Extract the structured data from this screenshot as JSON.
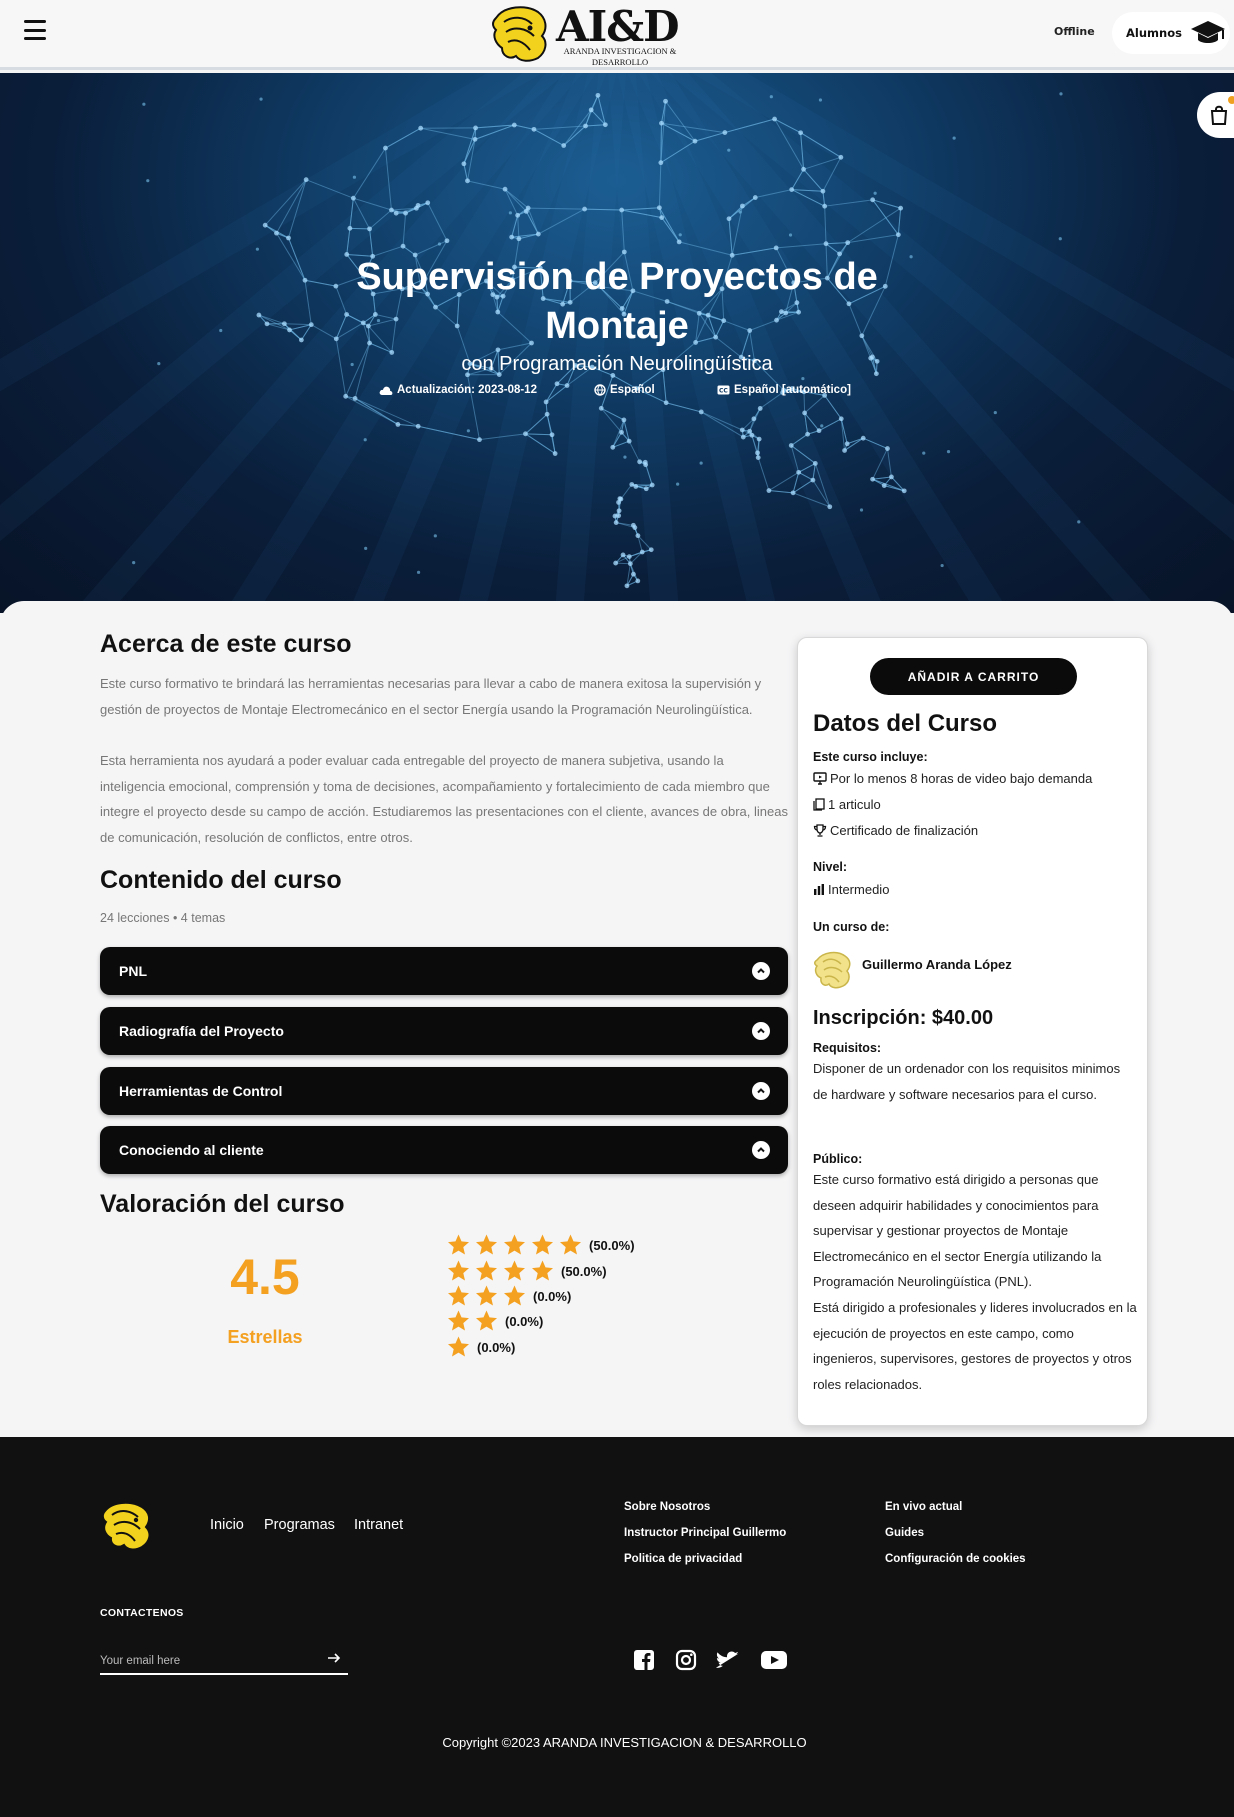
{
  "header": {
    "logo_text": "AI&D",
    "logo_subtitle": "ARANDA INVESTIGACION & DESARROLLO",
    "status": "Offline",
    "students_button": "Alumnos"
  },
  "hero": {
    "title": "Supervisión de Proyectos de Montaje",
    "subtitle": "con Programación Neurolingüística",
    "updated": "Actualización: 2023-08-12",
    "language": "Español",
    "captions": "Español [automático]"
  },
  "about": {
    "heading": "Acerca de este curso",
    "paragraphs": [
      "Este curso formativo te brindará las herramientas necesarias para llevar a cabo de manera exitosa la supervisión y gestión de proyectos de Montaje Electromecánico en el sector Energía usando la Programación Neurolingüística.",
      "Esta herramienta nos ayudará a poder evaluar cada entregable del proyecto de manera subjetiva, usando la inteligencia emocional, comprensión y toma de decisiones, acompañamiento y fortalecimiento de cada miembro que integre el proyecto desde su campo de acción. Estudiaremos las presentaciones con el cliente, avances de obra, lineas de comunicación, resolución de conflictos, entre otros."
    ]
  },
  "content": {
    "heading": "Contenido del curso",
    "summary": "24 lecciones • 4 temas",
    "modules": [
      "PNL",
      "Radiografía del Proyecto",
      "Herramientas de Control",
      "Conociendo al cliente"
    ]
  },
  "rating": {
    "heading": "Valoración del curso",
    "score": "4.5",
    "label": "Estrellas",
    "breakdown": [
      {
        "stars": 5,
        "percent": "(50.0%)"
      },
      {
        "stars": 4,
        "percent": "(50.0%)"
      },
      {
        "stars": 3,
        "percent": "(0.0%)"
      },
      {
        "stars": 2,
        "percent": "(0.0%)"
      },
      {
        "stars": 1,
        "percent": "(0.0%)"
      }
    ]
  },
  "sidebar": {
    "add_to_cart": "AÑADIR A CARRITO",
    "heading": "Datos del Curso",
    "includes_label": "Este curso incluye:",
    "includes": [
      "Por lo menos 8 horas de video bajo demanda",
      "1 articulo",
      "Certificado de finalización"
    ],
    "level_label": "Nivel:",
    "level": "Intermedio",
    "author_label": "Un curso de:",
    "author": "Guillermo Aranda López",
    "price": "Inscripción: $40.00",
    "requirements_label": "Requisitos:",
    "requirements": "Disponer de un ordenador con los requisitos minimos de hardware y software necesarios para el curso.",
    "audience_label": "Público:",
    "audience": [
      "Este curso formativo está dirigido a personas que deseen adquirir habilidades y conocimientos para supervisar y gestionar proyectos de Montaje Electromecánico en el sector Energía utilizando la Programación Neurolingüística (PNL).",
      "Está dirigido a profesionales y lideres involucrados en la ejecución de proyectos en este campo, como ingenieros, supervisores, gestores de proyectos y otros roles relacionados."
    ]
  },
  "footer": {
    "nav": [
      "Inicio",
      "Programas",
      "Intranet"
    ],
    "links_col1": [
      "Sobre Nosotros",
      "Instructor Principal Guillermo",
      "Politica de privacidad"
    ],
    "links_col2": [
      "En vivo actual",
      "Guides",
      "Configuración de cookies"
    ],
    "contact_label": "CONTACTENOS",
    "email_placeholder": "Your email here",
    "copyright": "Copyright ©2023 ARANDA INVESTIGACION & DESARROLLO"
  },
  "colors": {
    "accent": "#f4a020",
    "dark": "#0b0b0b",
    "hero_blue": "#0f3a63"
  }
}
